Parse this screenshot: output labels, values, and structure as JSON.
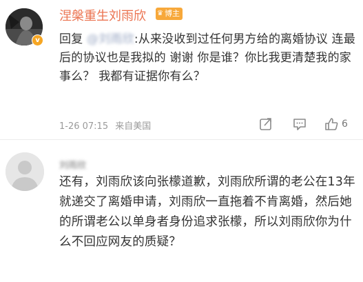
{
  "comments": [
    {
      "username": "涅槃重生刘雨欣",
      "badge": "博主",
      "reply_prefix": "回复",
      "reply_target": "@刘雨欣",
      "text": ":从来没收到过任何男方给的离婚协议 连最后的协议也是我拟的 谢谢 你是谁？你比我更清楚我的家事么？ 我都有证据你有么？",
      "time": "1-26 07:15",
      "source": "来自美国",
      "likes": "6"
    },
    {
      "username": "刘雨欣",
      "text": "还有，刘雨欣该向张檬道歉，刘雨欣所谓的老公在13年就递交了离婚申请，刘雨欣一直拖着不肯离婚，然后她的所谓老公以单身者身份追求张檬，所以刘雨欣你为什么不回应网友的质疑？"
    }
  ],
  "icons": {
    "verified": "v-badge-icon",
    "forward": "share-icon",
    "reply": "comment-icon",
    "like": "thumbs-up-icon"
  },
  "colors": {
    "username": "#eb7350",
    "badge": "#f7a83a",
    "meta": "#9a9a9a",
    "link": "#5d6f9c"
  }
}
